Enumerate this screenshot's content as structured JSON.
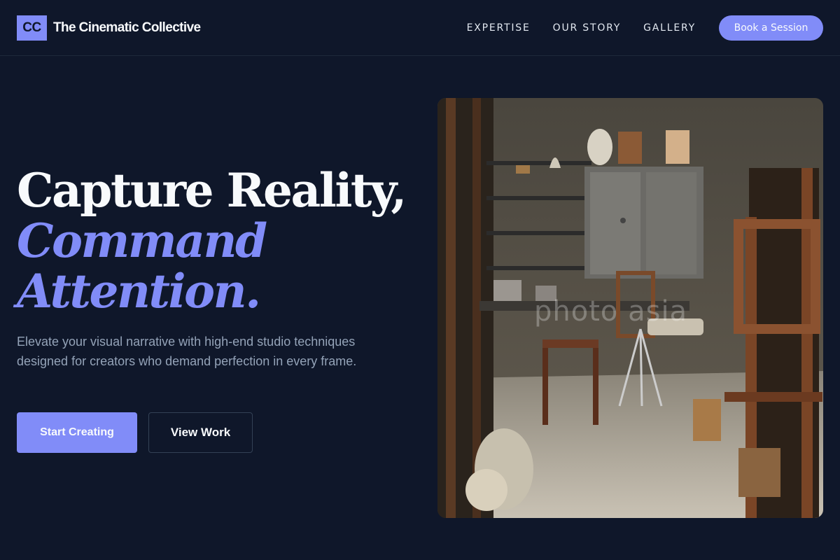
{
  "brand": {
    "logo_text": "CC",
    "name": "The Cinematic Collective"
  },
  "nav": {
    "links": [
      "EXPERTISE",
      "OUR STORY",
      "GALLERY"
    ],
    "cta_label": "Book a Session"
  },
  "hero": {
    "headline_line1": "Capture Reality,",
    "headline_line2": "Command",
    "headline_line3": "Attention.",
    "subtext": "Elevate your visual narrative with high-end studio techniques designed for creators who demand perfection in every frame.",
    "primary_button": "Start Creating",
    "secondary_button": "View Work",
    "image_watermark": "photo asia"
  },
  "colors": {
    "background": "#0f172a",
    "accent": "#818cf8",
    "text_primary": "#f8fafc",
    "text_muted": "#94a3b8"
  }
}
